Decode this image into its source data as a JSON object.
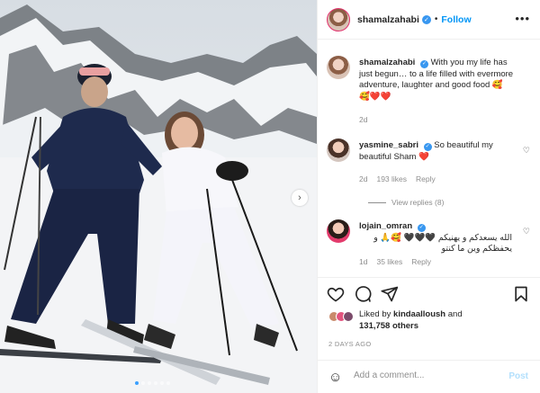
{
  "post": {
    "author": "shamalzahabi",
    "follow_label": "Follow",
    "more_icon": "more-options-icon"
  },
  "caption": {
    "username": "shamalzahabi",
    "text": "With you my life has just begun… to a life filled with evermore adventure, laughter and good food 🥰",
    "emojis": "🥰❤️❤️",
    "time": "2d"
  },
  "comments": [
    {
      "username": "yasmine_sabri",
      "text": "So beautiful my beautiful Sham ❤️",
      "time": "2d",
      "likes": "193 likes",
      "reply": "Reply",
      "view_replies": "View replies (8)"
    },
    {
      "username": "lojain_omran",
      "text": "الله يسعدكم و يهنيكم 🖤🖤🖤 🥰🙏 و يحفظكم وين ما كنتو",
      "time": "1d",
      "likes": "35 likes",
      "reply": "Reply"
    }
  ],
  "likes": {
    "prefix": "Liked by",
    "user": "kindaalloush",
    "connector": "and",
    "others": "131,758 others"
  },
  "time_ago": "2 DAYS AGO",
  "comment_input": {
    "placeholder": "Add a comment...",
    "post_label": "Post"
  },
  "colors": {
    "accent": "#0095f6",
    "verified": "#3897f0",
    "heart": "#ed4956",
    "muted": "#8e8e8e"
  }
}
